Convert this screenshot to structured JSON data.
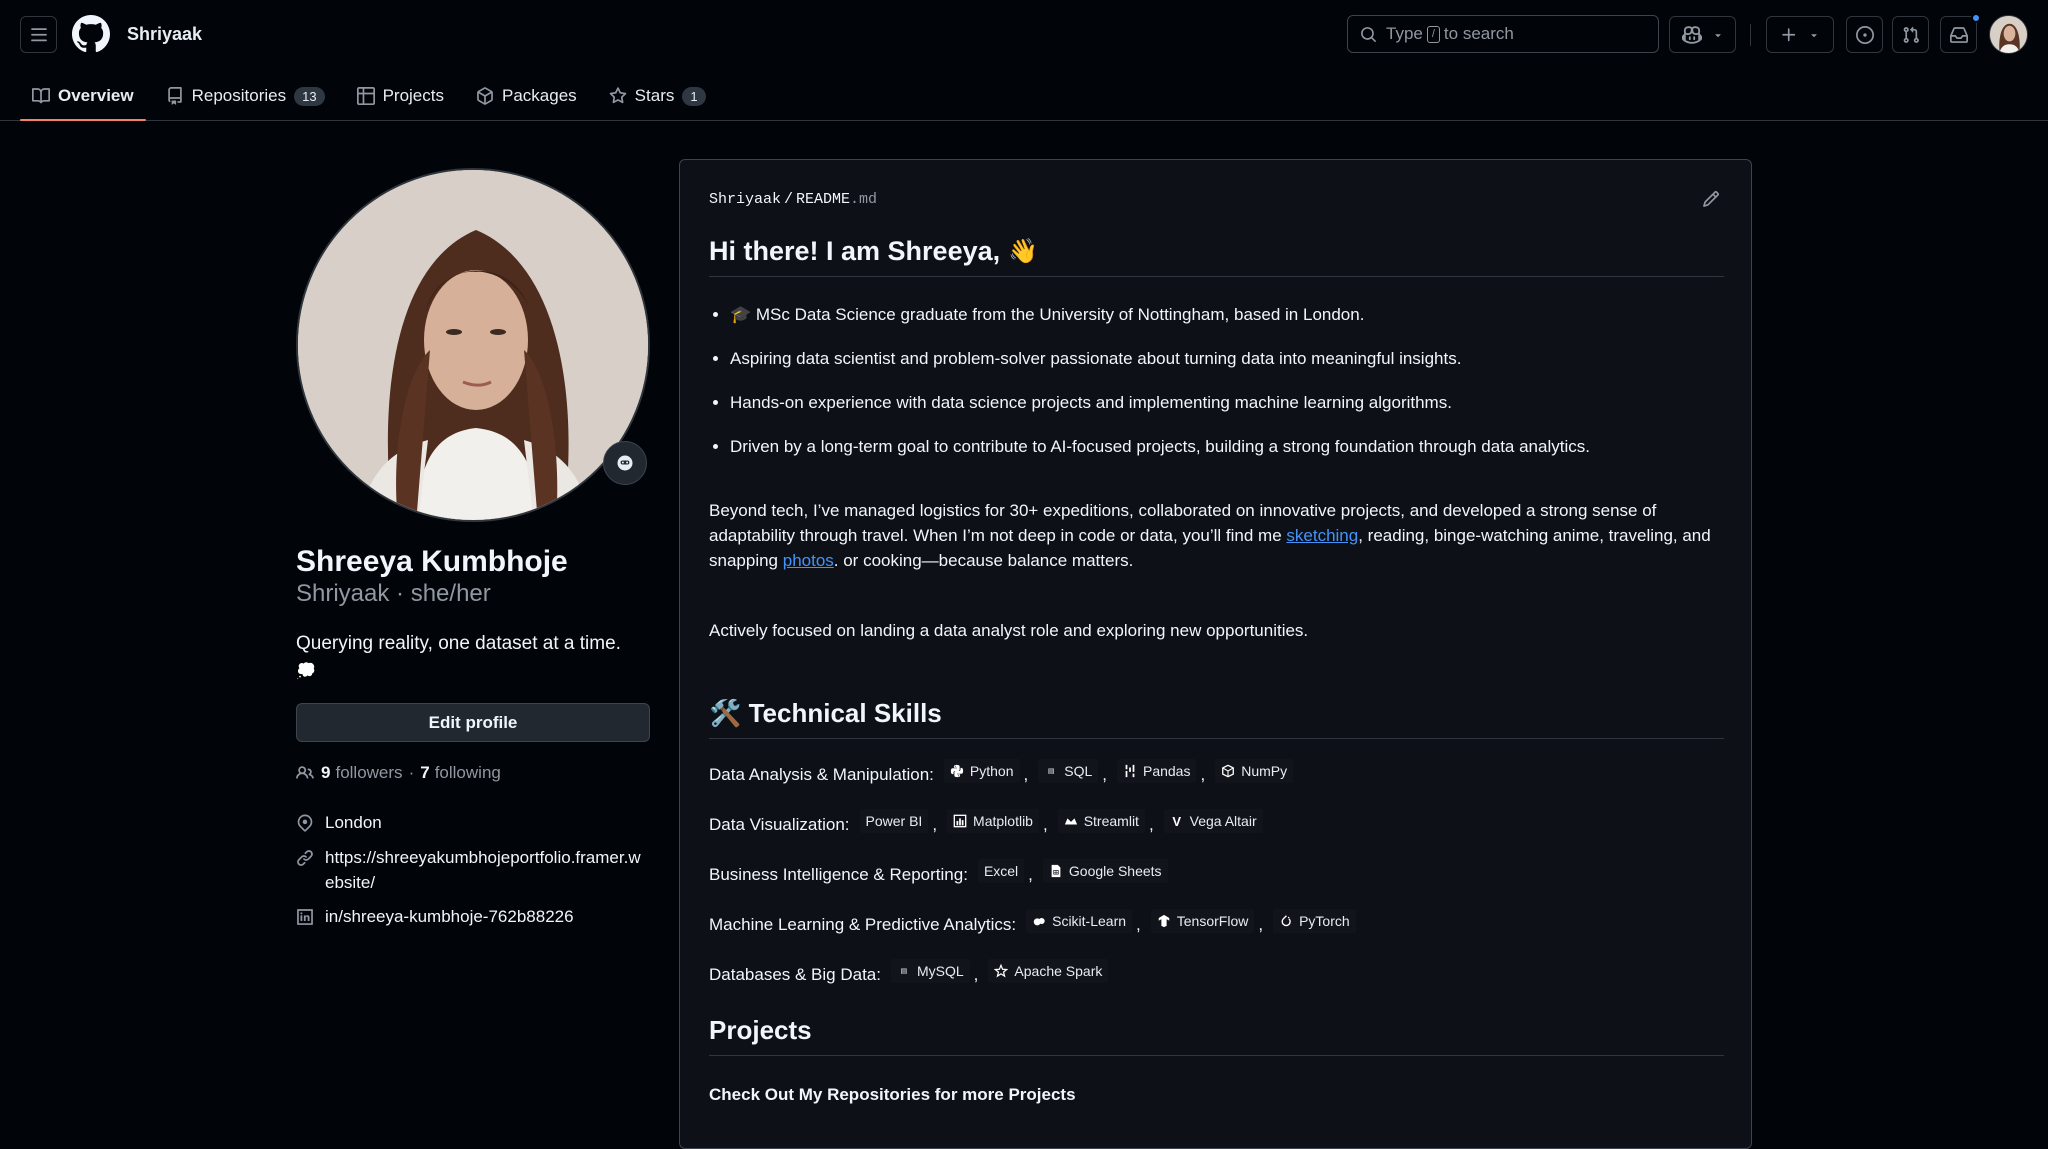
{
  "header": {
    "username": "Shriyaak",
    "search_prefix": "Type",
    "search_key": "/",
    "search_suffix": "to search"
  },
  "nav": {
    "tabs": [
      {
        "label": "Overview",
        "icon": "book-icon",
        "active": true
      },
      {
        "label": "Repositories",
        "icon": "repo-icon",
        "count": "13"
      },
      {
        "label": "Projects",
        "icon": "table-icon"
      },
      {
        "label": "Packages",
        "icon": "package-icon"
      },
      {
        "label": "Stars",
        "icon": "star-icon",
        "count": "1"
      }
    ]
  },
  "profile": {
    "name": "Shreeya Kumbhoje",
    "login_line": "Shriyaak · she/her",
    "bio": "Querying reality, one dataset at a time.",
    "bio_emoji": "💭",
    "edit_label": "Edit profile",
    "followers_count": "9",
    "followers_label": "followers",
    "following_count": "7",
    "following_label": "following",
    "location": "London",
    "website": "https://shreeyakumbhojeportfolio.framer.website/",
    "linkedin": "in/shreeya-kumbhoje-762b88226"
  },
  "readme": {
    "path_user": "Shriyaak",
    "path_sep": "/",
    "path_file": "README",
    "path_ext": ".md",
    "heading": "Hi there! I am Shreeya,",
    "heading_emoji": "👋",
    "bullets": [
      "🎓 MSc Data Science graduate from the University of Nottingham, based in London.",
      "Aspiring data scientist and problem-solver passionate about turning data into meaningful insights.",
      "Hands-on experience with data science projects and implementing machine learning algorithms.",
      "Driven by a long-term goal to contribute to AI-focused projects, building a strong foundation through data analytics."
    ],
    "para1_a": "Beyond tech, I’ve managed logistics for 30+ expeditions, collaborated on innovative projects, and developed a strong sense of adaptability through travel. When I’m not deep in code or data, you’ll find me ",
    "para1_link1": "sketching",
    "para1_b": ", reading, binge-watching anime, traveling, and snapping ",
    "para1_link2": "photos",
    "para1_c": ". or cooking—because balance matters.",
    "para2": "Actively focused on landing a data analyst role and exploring new opportunities.",
    "skills_heading": "🛠️ Technical Skills",
    "skills": [
      {
        "label": "Data Analysis & Manipulation:",
        "badges": [
          "Python",
          "SQL",
          "Pandas",
          "NumPy"
        ]
      },
      {
        "label": "Data Visualization:",
        "badges": [
          "Power BI",
          "Matplotlib",
          "Streamlit",
          "Vega Altair"
        ]
      },
      {
        "label": "Business Intelligence & Reporting:",
        "badges": [
          "Excel",
          "Google Sheets"
        ]
      },
      {
        "label": "Machine Learning & Predictive Analytics:",
        "badges": [
          "Scikit-Learn",
          "TensorFlow",
          "PyTorch"
        ]
      },
      {
        "label": "Databases & Big Data:",
        "badges": [
          "MySQL",
          "Apache Spark"
        ]
      }
    ],
    "projects_heading": "Projects",
    "projects_sub": "Check Out My Repositories for more Projects"
  }
}
